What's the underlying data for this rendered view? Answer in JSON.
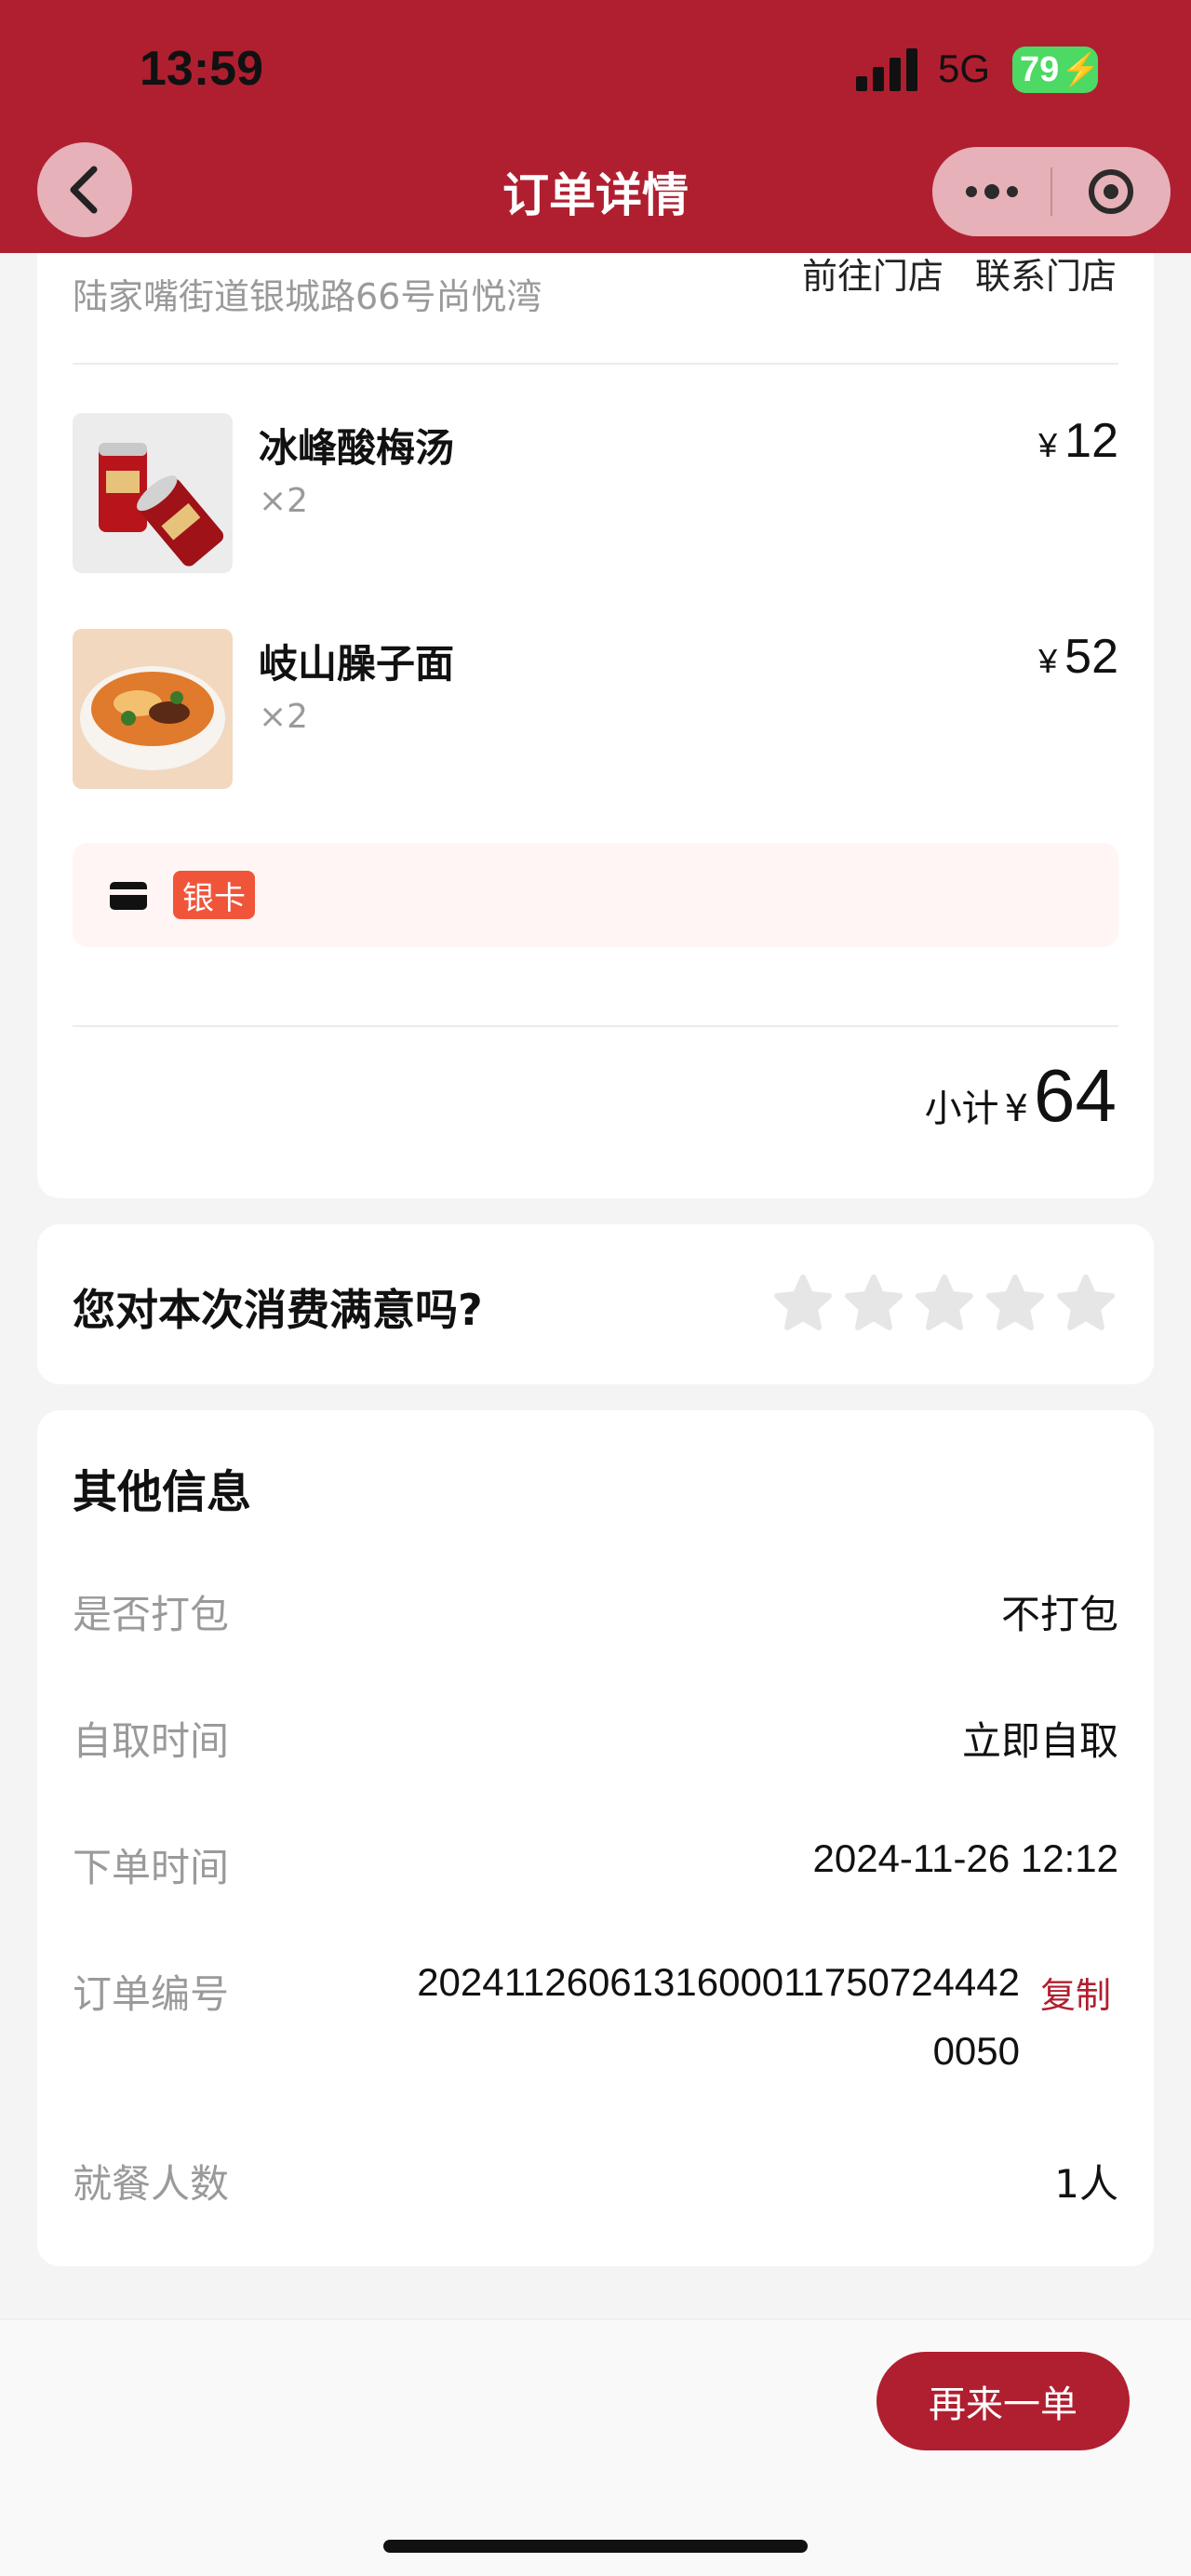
{
  "status_bar": {
    "time": "13:59",
    "network": "5G",
    "battery": "79"
  },
  "nav": {
    "title": "订单详情"
  },
  "store": {
    "address": "陆家嘴街道银城路66号尚悦湾",
    "go_to_store": "前往门店",
    "contact_store": "联系门店"
  },
  "items": [
    {
      "name": "冰峰酸梅汤",
      "qty": "×2",
      "currency": "¥",
      "price": "12"
    },
    {
      "name": "岐山臊子面",
      "qty": "×2",
      "currency": "¥",
      "price": "52"
    }
  ],
  "payment": {
    "method_badge": "银卡"
  },
  "subtotal": {
    "label": "小计",
    "currency": "¥",
    "amount": "64"
  },
  "rating": {
    "question": "您对本次消费满意吗?",
    "stars": 5,
    "selected": 0
  },
  "other_info": {
    "title": "其他信息",
    "rows": [
      {
        "label": "是否打包",
        "value": "不打包"
      },
      {
        "label": "自取时间",
        "value": "立即自取"
      },
      {
        "label": "下单时间",
        "value": "2024-11-26 12:12"
      },
      {
        "label": "订单编号",
        "value": "2024112606131600011750724442005​0",
        "copy": "复制"
      },
      {
        "label": "就餐人数",
        "value": "1人"
      }
    ]
  },
  "footer": {
    "reorder_label": "再来一单"
  }
}
